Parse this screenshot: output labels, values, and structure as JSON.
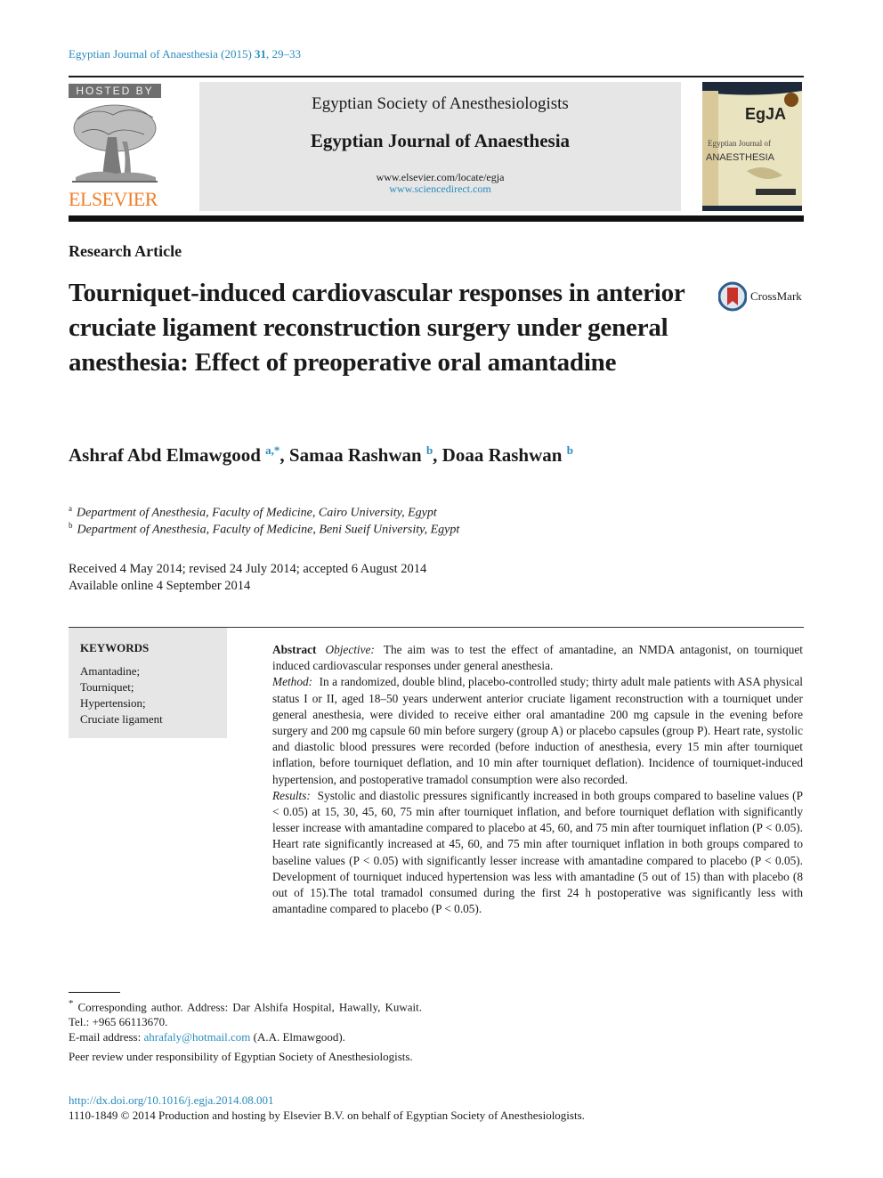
{
  "header": {
    "citation": {
      "journal_year": "Egyptian Journal of Anaesthesia (2015)",
      "volume": "31",
      "pages": ", 29–33"
    },
    "hosted_by": "HOSTED BY",
    "publisher_logo_text": "ELSEVIER",
    "society": "Egyptian Society of Anesthesiologists",
    "journal_name": "Egyptian Journal of Anaesthesia",
    "url_locate": "www.elsevier.com/locate/egja",
    "url_sciencedirect": "www.sciencedirect.com",
    "cover": {
      "abbrev": "EgJA",
      "line1": "Egyptian Journal of",
      "line2": "ANAESTHESIA"
    }
  },
  "article": {
    "type": "Research Article",
    "title": "Tourniquet-induced cardiovascular responses in anterior cruciate ligament reconstruction surgery under general anesthesia: Effect of preoperative oral amantadine",
    "crossmark_label": "CrossMark",
    "authors": [
      {
        "name": "Ashraf Abd Elmawgood",
        "sup": "a,*"
      },
      {
        "name": "Samaa Rashwan",
        "sup": "b"
      },
      {
        "name": "Doaa Rashwan",
        "sup": "b"
      }
    ],
    "affiliations": [
      {
        "key": "a",
        "text": "Department of Anesthesia, Faculty of Medicine, Cairo University, Egypt"
      },
      {
        "key": "b",
        "text": "Department of Anesthesia, Faculty of Medicine, Beni Sueif University, Egypt"
      }
    ],
    "dates": {
      "history": "Received 4 May 2014; revised 24 July 2014; accepted 6 August 2014",
      "online": "Available online 4 September 2014"
    }
  },
  "keywords": {
    "title": "KEYWORDS",
    "items": [
      "Amantadine;",
      "Tourniquet;",
      "Hypertension;",
      "Cruciate ligament"
    ]
  },
  "abstract": {
    "heading": "Abstract",
    "objective_label": "Objective:",
    "objective": "The aim was to test the effect of amantadine, an NMDA antagonist, on tourniquet induced cardiovascular responses under general anesthesia.",
    "method_label": "Method:",
    "method": "In a randomized, double blind, placebo-controlled study; thirty adult male patients with ASA physical status I or II, aged 18–50 years underwent anterior cruciate ligament reconstruction with a tourniquet under general anesthesia, were divided to receive either oral amantadine 200 mg capsule in the evening before surgery and 200 mg capsule 60 min before surgery (group A) or placebo capsules (group P). Heart rate, systolic and diastolic blood pressures were recorded (before induction of anesthesia, every 15 min after tourniquet inflation, before tourniquet deflation, and 10 min after tourniquet deflation). Incidence of tourniquet-induced hypertension, and postoperative tramadol consumption were also recorded.",
    "results_label": "Results:",
    "results": "Systolic and diastolic pressures significantly increased in both groups compared to baseline values (P < 0.05) at 15, 30, 45, 60, 75 min after tourniquet inflation, and before tourniquet deflation with significantly lesser increase with amantadine compared to placebo at 45, 60, and 75 min after tourniquet inflation (P < 0.05). Heart rate significantly increased at 45, 60, and 75 min after tourniquet inflation in both groups compared to baseline values (P < 0.05) with significantly lesser increase with amantadine compared to placebo (P < 0.05). Development of tourniquet induced hypertension was less with amantadine (5 out of 15) than with placebo (8 out of 15).The total tramadol consumed during the first 24 h postoperative was significantly less with amantadine compared to placebo (P < 0.05)."
  },
  "footnotes": {
    "corresponding_mark": "*",
    "corresponding": "Corresponding author. Address: Dar Alshifa Hospital, Hawally, Kuwait. Tel.: +965 66113670.",
    "email_label": "E-mail address: ",
    "email": "ahrafaly@hotmail.com",
    "email_owner": " (A.A. Elmawgood).",
    "peer_review": "Peer review under responsibility of Egyptian Society of Anesthesiologists."
  },
  "footer": {
    "doi": "http://dx.doi.org/10.1016/j.egja.2014.08.001",
    "copyright": "1110-1849 © 2014 Production and hosting by Elsevier B.V. on behalf of Egyptian Society of Anesthesiologists."
  },
  "colors": {
    "link": "#2a8bbd",
    "elsevier_orange": "#f07e26",
    "banner_gray": "#e6e6e6"
  }
}
